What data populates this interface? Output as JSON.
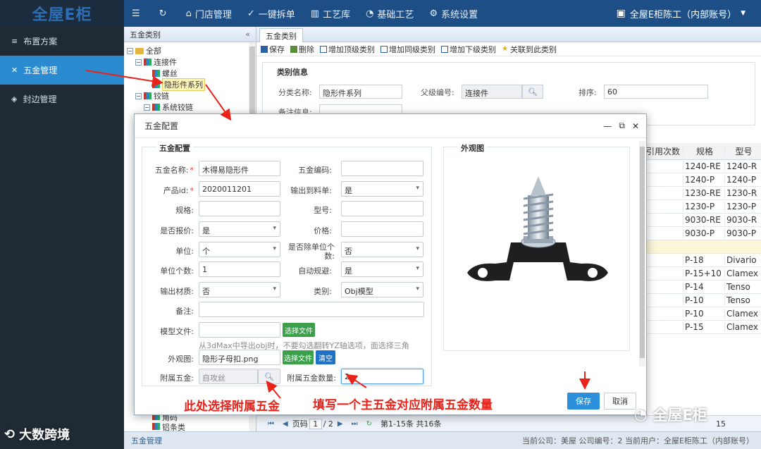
{
  "app": {
    "logo": "全屋E柜"
  },
  "topnav": [
    {
      "icon": "menu-icon",
      "label": ""
    },
    {
      "icon": "refresh-icon",
      "label": ""
    },
    {
      "icon": "store-icon",
      "label": "门店管理"
    },
    {
      "icon": "check-circle-icon",
      "label": "一键拆单"
    },
    {
      "icon": "chart-icon",
      "label": "工艺库"
    },
    {
      "icon": "dashboard-icon",
      "label": "基础工艺"
    },
    {
      "icon": "gear-icon",
      "label": "系统设置"
    }
  ],
  "user": {
    "name": "全屋E柜陈工（内部账号）"
  },
  "sidebar": {
    "items": [
      {
        "label": "布置方案",
        "active": false
      },
      {
        "label": "五金管理",
        "active": true
      },
      {
        "label": "封边管理",
        "active": false
      }
    ]
  },
  "tree_panel": {
    "title": "五金类别",
    "nodes": [
      {
        "label": "全部",
        "level": 0,
        "kind": "folder"
      },
      {
        "label": "连接件",
        "level": 1,
        "kind": "cat"
      },
      {
        "label": "螺丝",
        "level": 2,
        "kind": "cat"
      },
      {
        "label": "隐形件系列",
        "level": 2,
        "kind": "cat",
        "selected": true
      },
      {
        "label": "铰链",
        "level": 1,
        "kind": "cat"
      },
      {
        "label": "系统铰链",
        "level": 2,
        "kind": "cat"
      }
    ],
    "bottom_nodes": [
      "角码",
      "铝条类"
    ]
  },
  "content": {
    "tab": "五金类别",
    "toolbar": [
      "保存",
      "删除",
      "增加顶级类别",
      "增加同级类别",
      "增加下级类别",
      "关联到此类别"
    ],
    "category_info": {
      "legend": "类别信息",
      "name_label": "分类名称:",
      "name_value": "隐形件系列",
      "parent_label": "父级编号:",
      "parent_value": "连接件",
      "order_label": "排序:",
      "order_value": "60",
      "note_label": "备注信息:"
    }
  },
  "grid": {
    "headers": [
      "引用次数",
      "规格",
      "型号"
    ],
    "rows": [
      {
        "spec": "1240-RE",
        "model": "1240-R"
      },
      {
        "spec": "1240-P",
        "model": "1240-P"
      },
      {
        "spec": "1230-RE",
        "model": "1230-R"
      },
      {
        "spec": "1230-P",
        "model": "1230-P"
      },
      {
        "spec": "9030-RE",
        "model": "9030-R"
      },
      {
        "spec": "9030-P",
        "model": "9030-P"
      },
      {
        "spec": "",
        "model": ""
      },
      {
        "spec": "P-18",
        "model": "Divario"
      },
      {
        "spec": "P-15+10",
        "model": "Clamex"
      },
      {
        "spec": "P-14",
        "model": "Tenso"
      },
      {
        "spec": "P-10",
        "model": "Tenso"
      },
      {
        "spec": "P-10",
        "model": "Clamex"
      },
      {
        "spec": "P-15",
        "model": "Clamex"
      }
    ]
  },
  "pager": {
    "page_label": "页码",
    "page": "1",
    "total_pages": "/ 2",
    "range": "第1-15条 共16条",
    "per_page": "15"
  },
  "status": {
    "left": "五金管理",
    "right": "当前公司：美屋   公司编号：2   当前用户：全屋E柜陈工（内部账号）"
  },
  "modal": {
    "title": "五金配置",
    "config_legend": "五金配置",
    "appearance_legend": "外观图",
    "fields": {
      "name_label": "五金名称:",
      "name_value": "木得易隐形件",
      "code_label": "五金编码:",
      "code_value": "",
      "pid_label": "产品id:",
      "pid_value": "2020011201",
      "bom_label": "输出到料单:",
      "bom_value": "是",
      "spec_label": "规格:",
      "spec_value": "",
      "model_label": "型号:",
      "model_value": "",
      "quote_label": "是否报价:",
      "quote_value": "是",
      "price_label": "价格:",
      "price_value": "",
      "unit_label": "单位:",
      "unit_value": "个",
      "unitcount_q_label": "是否除单位个数:",
      "unitcount_q_value": "否",
      "unitcount_label": "单位个数:",
      "unitcount_value": "1",
      "avoid_label": "自动规避:",
      "avoid_value": "是",
      "material_label": "输出材质:",
      "material_value": "否",
      "type_label": "类别:",
      "type_value": "Obj模型",
      "remark_label": "备注:",
      "remark_value": "",
      "modelfile_label": "模型文件:",
      "modelfile_value": "",
      "choose_file": "选择文件",
      "modelfile_hint": "从3dMax中导出obj时，不要勾选翻转YZ轴选项，面选择三角",
      "appearance_label": "外观图:",
      "appearance_value": "隐形子母扣.png",
      "clear": "清空",
      "attach_label": "附属五金:",
      "attach_value": "自攻丝",
      "attach_qty_label": "附属五金数量:",
      "attach_qty_value": "2"
    },
    "save": "保存",
    "cancel": "取消"
  },
  "annotations": {
    "left": "此处选择附属五金",
    "right": "填写一个主五金对应附属五金数量"
  },
  "watermarks": {
    "left": "大数跨境",
    "right": "全屋E柜"
  }
}
